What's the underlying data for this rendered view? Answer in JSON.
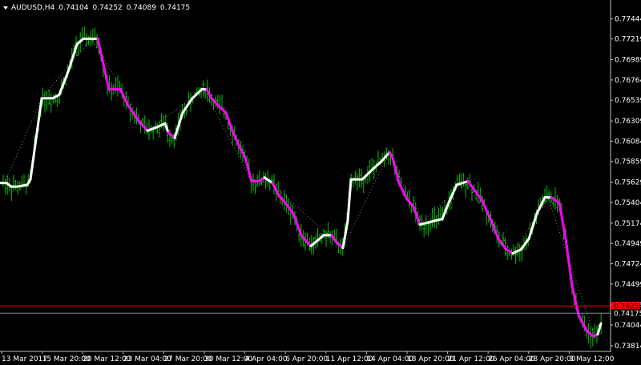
{
  "header": {
    "symbol": "AUDUSD,H4",
    "open": "0.74104",
    "high": "0.74252",
    "low": "0.74089",
    "close": "0.74175"
  },
  "colors": {
    "background": "#000000",
    "candles": "#00c000",
    "up_line": "#ffffff",
    "down_line": "#ff00ff",
    "ask_line": "#ff0000",
    "bid_line": "#8090a8",
    "axis": "#c0c0c0"
  },
  "price_tags": {
    "ask": "0.74255",
    "bid": "0.74175"
  },
  "chart_data": {
    "type": "line",
    "price_axis_ticks": [
      "0.77444",
      "0.77219",
      "0.76989",
      "0.76764",
      "0.76539",
      "0.76309",
      "0.76084",
      "0.75859",
      "0.75629",
      "0.75404",
      "0.75174",
      "0.74949",
      "0.74724",
      "0.74499",
      "0.74269",
      "0.74044",
      "0.73814"
    ],
    "time_axis_ticks": [
      "13 Mar 2017",
      "15 Mar 20:00",
      "20 Mar 12:00",
      "23 Mar 04:00",
      "27 Mar 20:00",
      "30 Mar 12:00",
      "4 Apr 04:00",
      "6 Apr 20:00",
      "11 Apr 12:00",
      "14 Apr 04:00",
      "18 Apr 20:00",
      "21 Apr 12:00",
      "26 Apr 04:00",
      "28 Apr 20:00",
      "3 May 12:00"
    ],
    "ylim": [
      0.7376,
      0.7758
    ],
    "ask_price": 0.74255,
    "bid_price": 0.74175,
    "indicator": [
      [
        0,
        0.7562
      ],
      [
        8,
        0.7562
      ],
      [
        14,
        0.7558
      ],
      [
        22,
        0.7558
      ],
      [
        34,
        0.756
      ],
      [
        38,
        0.7566
      ],
      [
        52,
        0.7656
      ],
      [
        66,
        0.7656
      ],
      [
        74,
        0.766
      ],
      [
        86,
        0.7688
      ],
      [
        96,
        0.7716
      ],
      [
        104,
        0.7722
      ],
      [
        122,
        0.7722
      ],
      [
        128,
        0.7698
      ],
      [
        136,
        0.7666
      ],
      [
        150,
        0.7666
      ],
      [
        160,
        0.7648
      ],
      [
        174,
        0.763
      ],
      [
        184,
        0.762
      ],
      [
        196,
        0.7624
      ],
      [
        206,
        0.7628
      ],
      [
        210,
        0.7618
      ],
      [
        218,
        0.7612
      ],
      [
        228,
        0.764
      ],
      [
        240,
        0.7656
      ],
      [
        252,
        0.7666
      ],
      [
        258,
        0.7666
      ],
      [
        264,
        0.7656
      ],
      [
        272,
        0.7648
      ],
      [
        282,
        0.764
      ],
      [
        290,
        0.762
      ],
      [
        298,
        0.7604
      ],
      [
        306,
        0.759
      ],
      [
        314,
        0.7564
      ],
      [
        324,
        0.7564
      ],
      [
        330,
        0.7568
      ],
      [
        340,
        0.7562
      ],
      [
        348,
        0.7548
      ],
      [
        356,
        0.754
      ],
      [
        366,
        0.7528
      ],
      [
        376,
        0.7504
      ],
      [
        388,
        0.7492
      ],
      [
        396,
        0.7498
      ],
      [
        404,
        0.7504
      ],
      [
        414,
        0.7504
      ],
      [
        420,
        0.7496
      ],
      [
        428,
        0.749
      ],
      [
        434,
        0.752
      ],
      [
        438,
        0.7566
      ],
      [
        452,
        0.7566
      ],
      [
        466,
        0.7578
      ],
      [
        476,
        0.7586
      ],
      [
        486,
        0.7596
      ],
      [
        490,
        0.759
      ],
      [
        498,
        0.7562
      ],
      [
        508,
        0.7544
      ],
      [
        516,
        0.7536
      ],
      [
        524,
        0.7516
      ],
      [
        534,
        0.7518
      ],
      [
        542,
        0.752
      ],
      [
        552,
        0.7522
      ],
      [
        560,
        0.754
      ],
      [
        570,
        0.756
      ],
      [
        584,
        0.7564
      ],
      [
        594,
        0.7552
      ],
      [
        602,
        0.7542
      ],
      [
        612,
        0.7522
      ],
      [
        622,
        0.75
      ],
      [
        632,
        0.7488
      ],
      [
        640,
        0.7484
      ],
      [
        650,
        0.7488
      ],
      [
        660,
        0.75
      ],
      [
        670,
        0.7528
      ],
      [
        680,
        0.7546
      ],
      [
        688,
        0.7546
      ],
      [
        698,
        0.754
      ],
      [
        706,
        0.75
      ],
      [
        714,
        0.7448
      ],
      [
        722,
        0.7416
      ],
      [
        732,
        0.7398
      ],
      [
        740,
        0.7392
      ],
      [
        746,
        0.7394
      ],
      [
        750,
        0.7406
      ]
    ],
    "down_ranges": [
      [
        122,
        184
      ],
      [
        210,
        218
      ],
      [
        258,
        330
      ],
      [
        340,
        388
      ],
      [
        414,
        428
      ],
      [
        486,
        524
      ],
      [
        584,
        640
      ],
      [
        688,
        746
      ]
    ]
  }
}
